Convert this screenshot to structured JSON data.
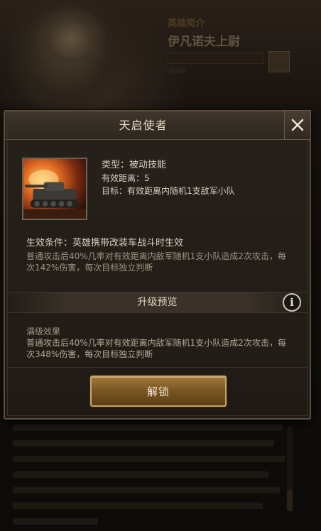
{
  "background": {
    "hero_title": "英雄简介",
    "hero_name": "伊凡诺夫上尉"
  },
  "dialog": {
    "title": "天启使者",
    "close_icon": "close-icon",
    "skill": {
      "type": "类型：被动技能",
      "range": "有效距离：5",
      "target": "目标：有效距离内随机1支敌军小队",
      "image": "tank-skill-image"
    },
    "condition": {
      "title": "生效条件：英雄携带改装车战斗时生效",
      "description": "普通攻击后40%几率对有效距离内敌军随机1支小队造成2次攻击，每次142%伤害，每次目标独立判断"
    },
    "upgrade_preview": {
      "title": "升级预览",
      "info_icon": "info-icon"
    },
    "max_effect": {
      "title": "满级效果",
      "description": "普通攻击后40%几率对有效距离内敌军随机1支小队造成2次攻击，每次348%伤害，每次目标独立判断"
    },
    "unlock_label": "解锁"
  },
  "colors": {
    "accent_gold": "#c9a467",
    "panel_bg": "#1f1a15",
    "text_primary": "#d9d0c0",
    "text_secondary": "#9d9482"
  }
}
